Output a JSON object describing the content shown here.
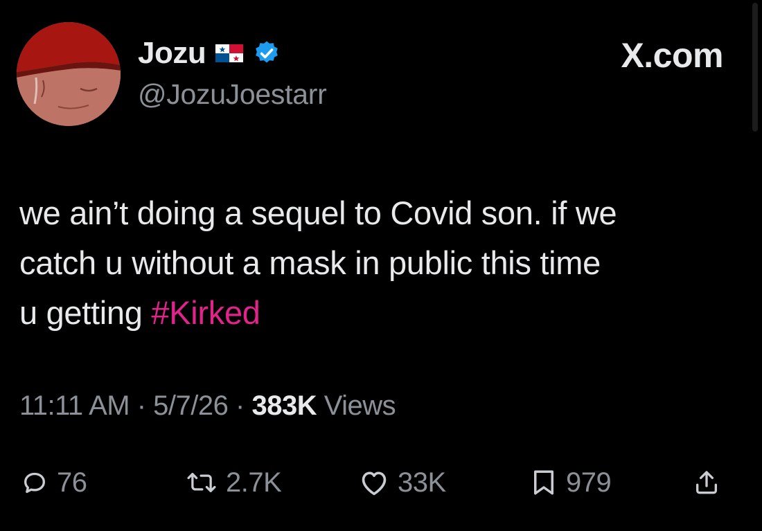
{
  "header": {
    "display_name": "Jozu",
    "handle": "@JozuJoestarr",
    "site": "X.com",
    "flag_icon": "panama-flag-icon",
    "verified_icon": "verified-badge-icon",
    "verified_color": "#1d9bf0"
  },
  "tweet": {
    "line1": "we ain’t doing a sequel to Covid son. if we",
    "line2": "catch u without a mask in public this time",
    "line3_prefix": "u getting ",
    "hashtag": "#Kirked",
    "hashtag_color": "#e3238c"
  },
  "meta": {
    "time": "11:11 AM",
    "sep1": "·",
    "date": "5/7/26",
    "sep2": "·",
    "views_count": "383K",
    "views_label": "Views"
  },
  "actions": {
    "replies": "76",
    "reposts": "2.7K",
    "likes": "33K",
    "bookmarks": "979",
    "icons": [
      "reply-icon",
      "repost-icon",
      "like-icon",
      "bookmark-icon",
      "share-icon"
    ]
  }
}
